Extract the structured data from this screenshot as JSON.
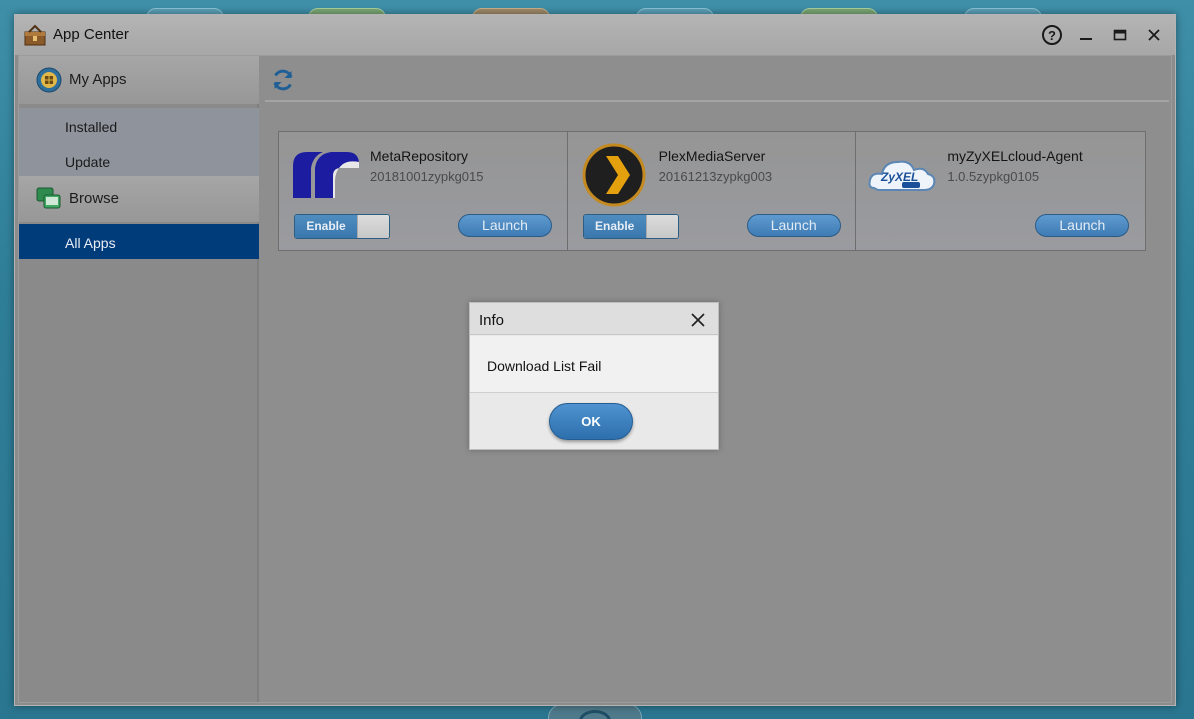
{
  "window": {
    "title": "App Center",
    "help_label": "?",
    "minimize_label": "–",
    "close_label": "×"
  },
  "sidebar": {
    "my_apps": {
      "label": "My Apps",
      "items": [
        {
          "label": "Installed",
          "active": false
        },
        {
          "label": "Update",
          "active": false
        }
      ]
    },
    "browse": {
      "label": "Browse",
      "items": [
        {
          "label": "All Apps",
          "active": true
        }
      ]
    }
  },
  "apps": [
    {
      "name": "MetaRepository",
      "version": "20181001zypkg015",
      "toggle_label": "Enable",
      "launch_label": "Launch",
      "logo": "meta-repository-logo"
    },
    {
      "name": "PlexMediaServer",
      "version": "20161213zypkg003",
      "toggle_label": "Enable",
      "launch_label": "Launch",
      "logo": "plex-logo"
    },
    {
      "name": "myZyXELcloud-Agent",
      "version": "1.0.5zypkg0105",
      "launch_label": "Launch",
      "logo": "zyxel-cloud-logo"
    }
  ],
  "dialog": {
    "title": "Info",
    "message": "Download List Fail",
    "ok_label": "OK"
  },
  "colors": {
    "accent": "#003b7a",
    "button": "#3f7bb4"
  }
}
